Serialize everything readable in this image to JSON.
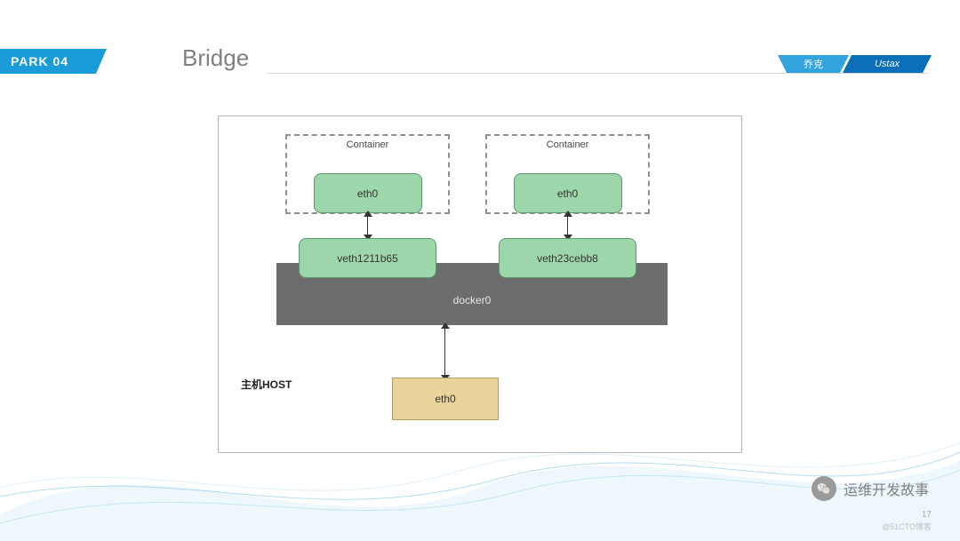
{
  "header": {
    "tab": "PARK 04",
    "title": "Bridge",
    "badge1": "乔克",
    "badge2": "Ustax"
  },
  "diagram": {
    "container_label": "Container",
    "eth0": "eth0",
    "veth_left": "veth1211b65",
    "veth_right": "veth23cebb8",
    "docker0": "docker0",
    "host_label": "主机HOST",
    "host_eth": "eth0"
  },
  "footer": {
    "watermark": "运维开发故事",
    "page_number": "17",
    "credit": "@51CTO博客"
  },
  "colors": {
    "green_box": "#9ed6ab",
    "green_border": "#5a9a6b",
    "gray_box": "#6d6d6d",
    "yellow_box": "#ead39a",
    "blue_tab": "#1b9bd8",
    "blue_badge1": "#33a3dd",
    "blue_badge2": "#0a6fb8"
  }
}
